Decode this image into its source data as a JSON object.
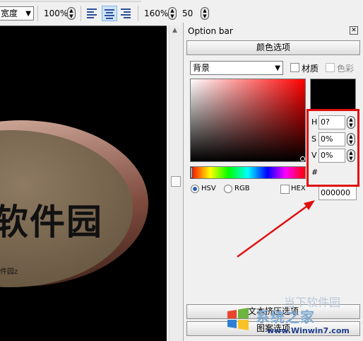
{
  "toolbar": {
    "font_size_combo": "宽度",
    "zoom_value": "100%",
    "zoom2_value": "160%",
    "count_value": "50"
  },
  "canvas": {
    "main_text": "软件园",
    "sub_text": "件园z"
  },
  "panel": {
    "title": "Option bar",
    "color_section_label": "颜色选项",
    "target_select": "背景",
    "material_label": "材质",
    "color_label": "色彩",
    "fields": {
      "h_label": "H",
      "h_value": "0?",
      "s_label": "S",
      "s_value": "0%",
      "v_label": "V",
      "v_value": "0%",
      "hex_label": "#",
      "hex_value": "000000"
    },
    "modes": {
      "hsv": "HSV",
      "rgb": "RGB",
      "hex": "HEX"
    },
    "selected_color": "#000000",
    "text_pressure_label": "文本挤压选项",
    "pattern_label": "图案选项"
  },
  "watermark": {
    "brand_big": "系统之家",
    "site": "www.Winwin7.com",
    "ghost": "当下软件园"
  },
  "colors": {
    "highlight": "#e01010"
  }
}
